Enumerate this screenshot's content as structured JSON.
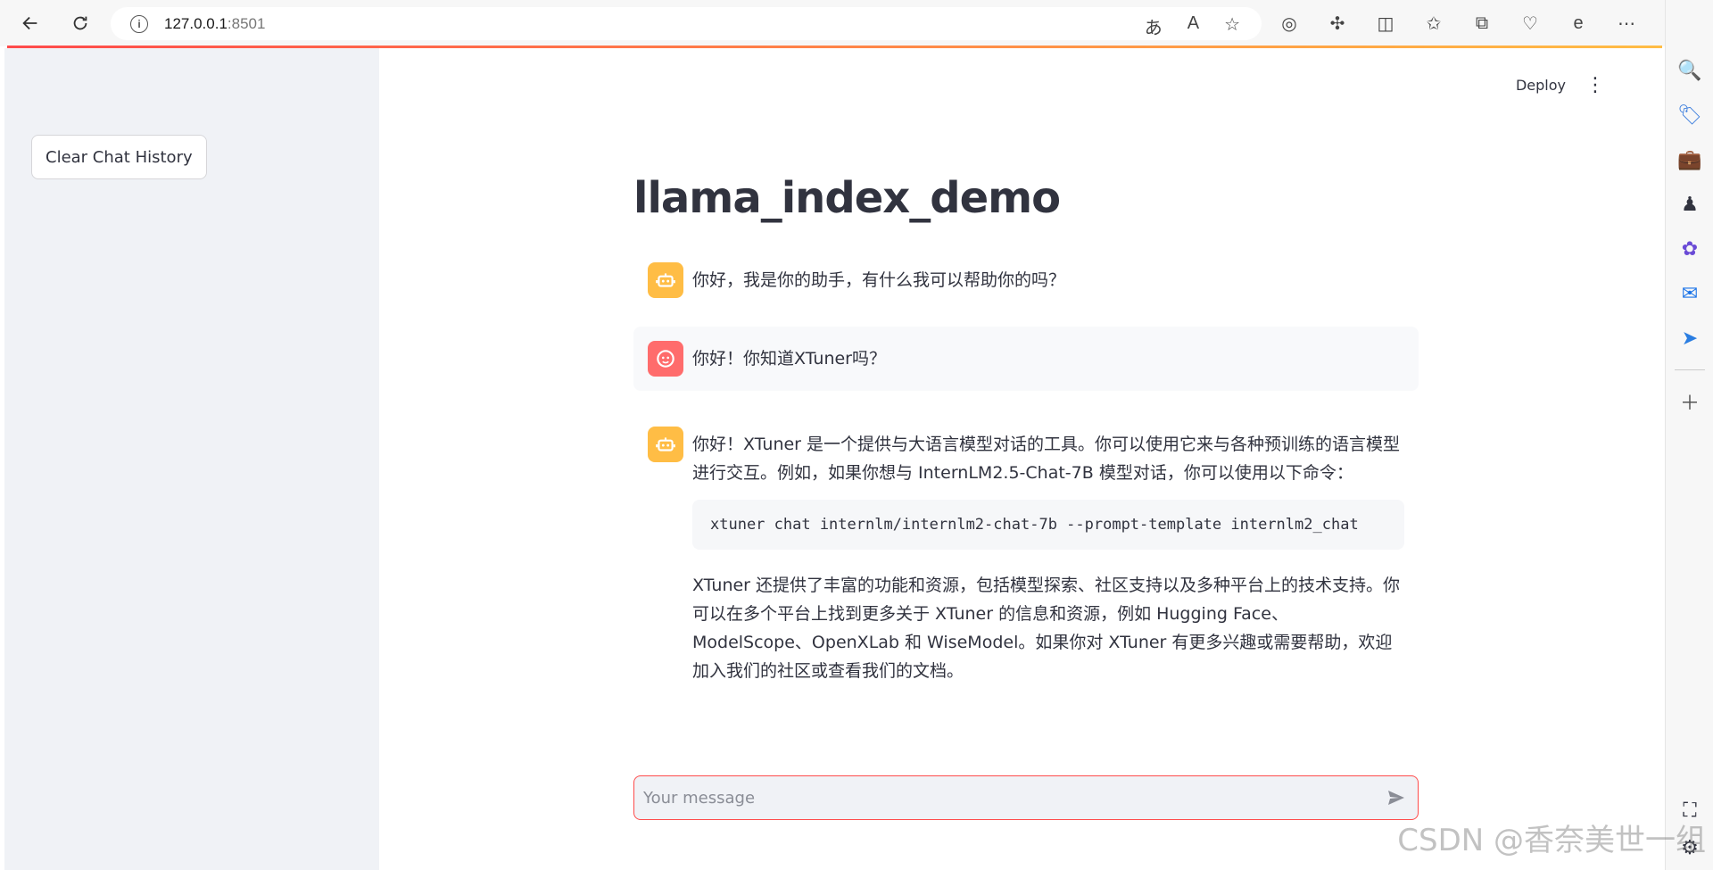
{
  "browser": {
    "host": "127.0.0.1",
    "port": ":8501"
  },
  "sidebar": {
    "clear_button_label": "Clear Chat History"
  },
  "header": {
    "deploy_label": "Deploy"
  },
  "main": {
    "title": "llama_index_demo",
    "messages": [
      {
        "role": "assistant",
        "text": "你好，我是你的助手，有什么我可以帮助你的吗？"
      },
      {
        "role": "user",
        "text": "你好！你知道XTuner吗？"
      },
      {
        "role": "assistant",
        "intro": "你好！XTuner 是一个提供与大语言模型对话的工具。你可以使用它来与各种预训练的语言模型进行交互。例如，如果你想与 InternLM2.5-Chat-7B 模型对话，你可以使用以下命令：",
        "code": "xtuner chat internlm/internlm2-chat-7b --prompt-template internlm2_chat",
        "outro": "XTuner 还提供了丰富的功能和资源，包括模型探索、社区支持以及多种平台上的技术支持。你可以在多个平台上找到更多关于 XTuner 的信息和资源，例如 Hugging Face、ModelScope、OpenXLab 和 WiseModel。如果你对 XTuner 有更多兴趣或需要帮助，欢迎加入我们的社区或查看我们的文档。"
      }
    ]
  },
  "chat_input": {
    "placeholder": "Your message"
  },
  "watermark": "CSDN @香奈美世一组",
  "colors": {
    "accent": "#ff4b4b",
    "bot_avatar": "#ffbd45",
    "user_avatar": "#ff6c6c",
    "sidebar_bg": "#f0f2f6"
  }
}
